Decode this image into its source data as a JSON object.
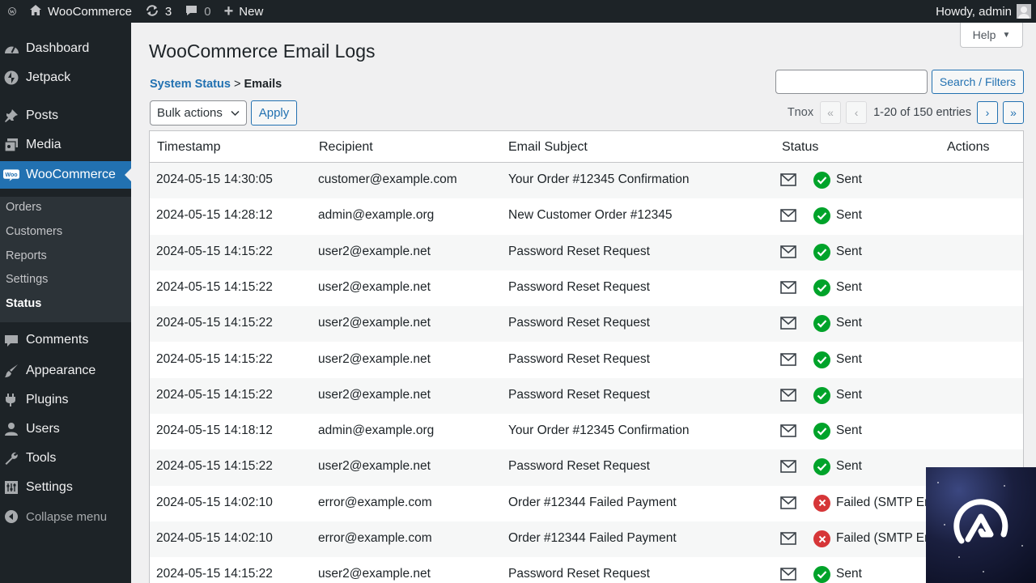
{
  "adminbar": {
    "site_name": "WooCommerce",
    "updates_count": "3",
    "comments_count": "0",
    "new_label": "New",
    "howdy": "Howdy, admin"
  },
  "sidebar": {
    "items": [
      {
        "label": "Dashboard",
        "icon": "dashboard-icon"
      },
      {
        "label": "Jetpack",
        "icon": "jetpack-icon"
      },
      {
        "label": "Posts",
        "icon": "pin-icon"
      },
      {
        "label": "Media",
        "icon": "media-icon"
      },
      {
        "label": "WooCommerce",
        "icon": "woo-icon",
        "current": true
      },
      {
        "label": "Comments",
        "icon": "comment-icon"
      },
      {
        "label": "Appearance",
        "icon": "brush-icon"
      },
      {
        "label": "Plugins",
        "icon": "plugin-icon"
      },
      {
        "label": "Users",
        "icon": "user-icon"
      },
      {
        "label": "Tools",
        "icon": "wrench-icon"
      },
      {
        "label": "Settings",
        "icon": "settings-icon"
      }
    ],
    "submenu": [
      "Orders",
      "Customers",
      "Reports",
      "Settings",
      "Status"
    ],
    "submenu_current": "Status",
    "collapse_label": "Collapse menu"
  },
  "header": {
    "help_label": "Help",
    "title": "WooCommerce Email Logs",
    "breadcrumb_link": "System Status",
    "breadcrumb_sep": " > ",
    "breadcrumb_current": "Emails"
  },
  "toolbar": {
    "search_value": "",
    "search_button": "Search / Filters",
    "bulk_actions": "Bulk actions",
    "apply": "Apply",
    "pagination_label": "Tnox",
    "first": "«",
    "prev": "‹",
    "count": "1-20 of 150 entries",
    "next": "›",
    "last": "»"
  },
  "table": {
    "columns": [
      "Timestamp",
      "Recipient",
      "Email Subject",
      "Status",
      "Actions"
    ],
    "rows": [
      {
        "timestamp": "2024-05-15 14:30:05",
        "recipient": "customer@example.com",
        "subject": "Your Order #12345 Confirmation",
        "status": "Sent",
        "state": "sent"
      },
      {
        "timestamp": "2024-05-15 14:28:12",
        "recipient": "admin@example.org",
        "subject": "New Customer Order #12345",
        "status": "Sent",
        "state": "sent"
      },
      {
        "timestamp": "2024-05-15 14:15:22",
        "recipient": "user2@example.net",
        "subject": "Password Reset Request",
        "status": "Sent",
        "state": "sent"
      },
      {
        "timestamp": "2024-05-15 14:15:22",
        "recipient": "user2@example.net",
        "subject": "Password Reset Request",
        "status": "Sent",
        "state": "sent"
      },
      {
        "timestamp": "2024-05-15 14:15:22",
        "recipient": "user2@example.net",
        "subject": "Password Reset Request",
        "status": "Sent",
        "state": "sent"
      },
      {
        "timestamp": "2024-05-15 14:15:22",
        "recipient": "user2@example.net",
        "subject": "Password Reset Request",
        "status": "Sent",
        "state": "sent"
      },
      {
        "timestamp": "2024-05-15 14:15:22",
        "recipient": "user2@example.net",
        "subject": "Password Reset Request",
        "status": "Sent",
        "state": "sent"
      },
      {
        "timestamp": "2024-05-15 14:18:12",
        "recipient": "admin@example.org",
        "subject": "Your Order #12345 Confirmation",
        "status": "Sent",
        "state": "sent"
      },
      {
        "timestamp": "2024-05-15 14:15:22",
        "recipient": "user2@example.net",
        "subject": "Password Reset Request",
        "status": "Sent",
        "state": "sent"
      },
      {
        "timestamp": "2024-05-15 14:02:10",
        "recipient": "error@example.com",
        "subject": "Order #12344 Failed Payment",
        "status": "Failed (SMTP Err",
        "state": "failed"
      },
      {
        "timestamp": "2024-05-15 14:02:10",
        "recipient": "error@example.com",
        "subject": "Order #12344 Failed Payment",
        "status": "Failed (SMTP Err",
        "state": "failed"
      },
      {
        "timestamp": "2024-05-15 14:15:22",
        "recipient": "user2@example.net",
        "subject": "Password Reset Request",
        "status": "Sent",
        "state": "sent"
      }
    ]
  },
  "colors": {
    "accent": "#2271b1",
    "sent": "#00a32a",
    "failed": "#d63638",
    "sidebar_bg": "#1d2327"
  }
}
